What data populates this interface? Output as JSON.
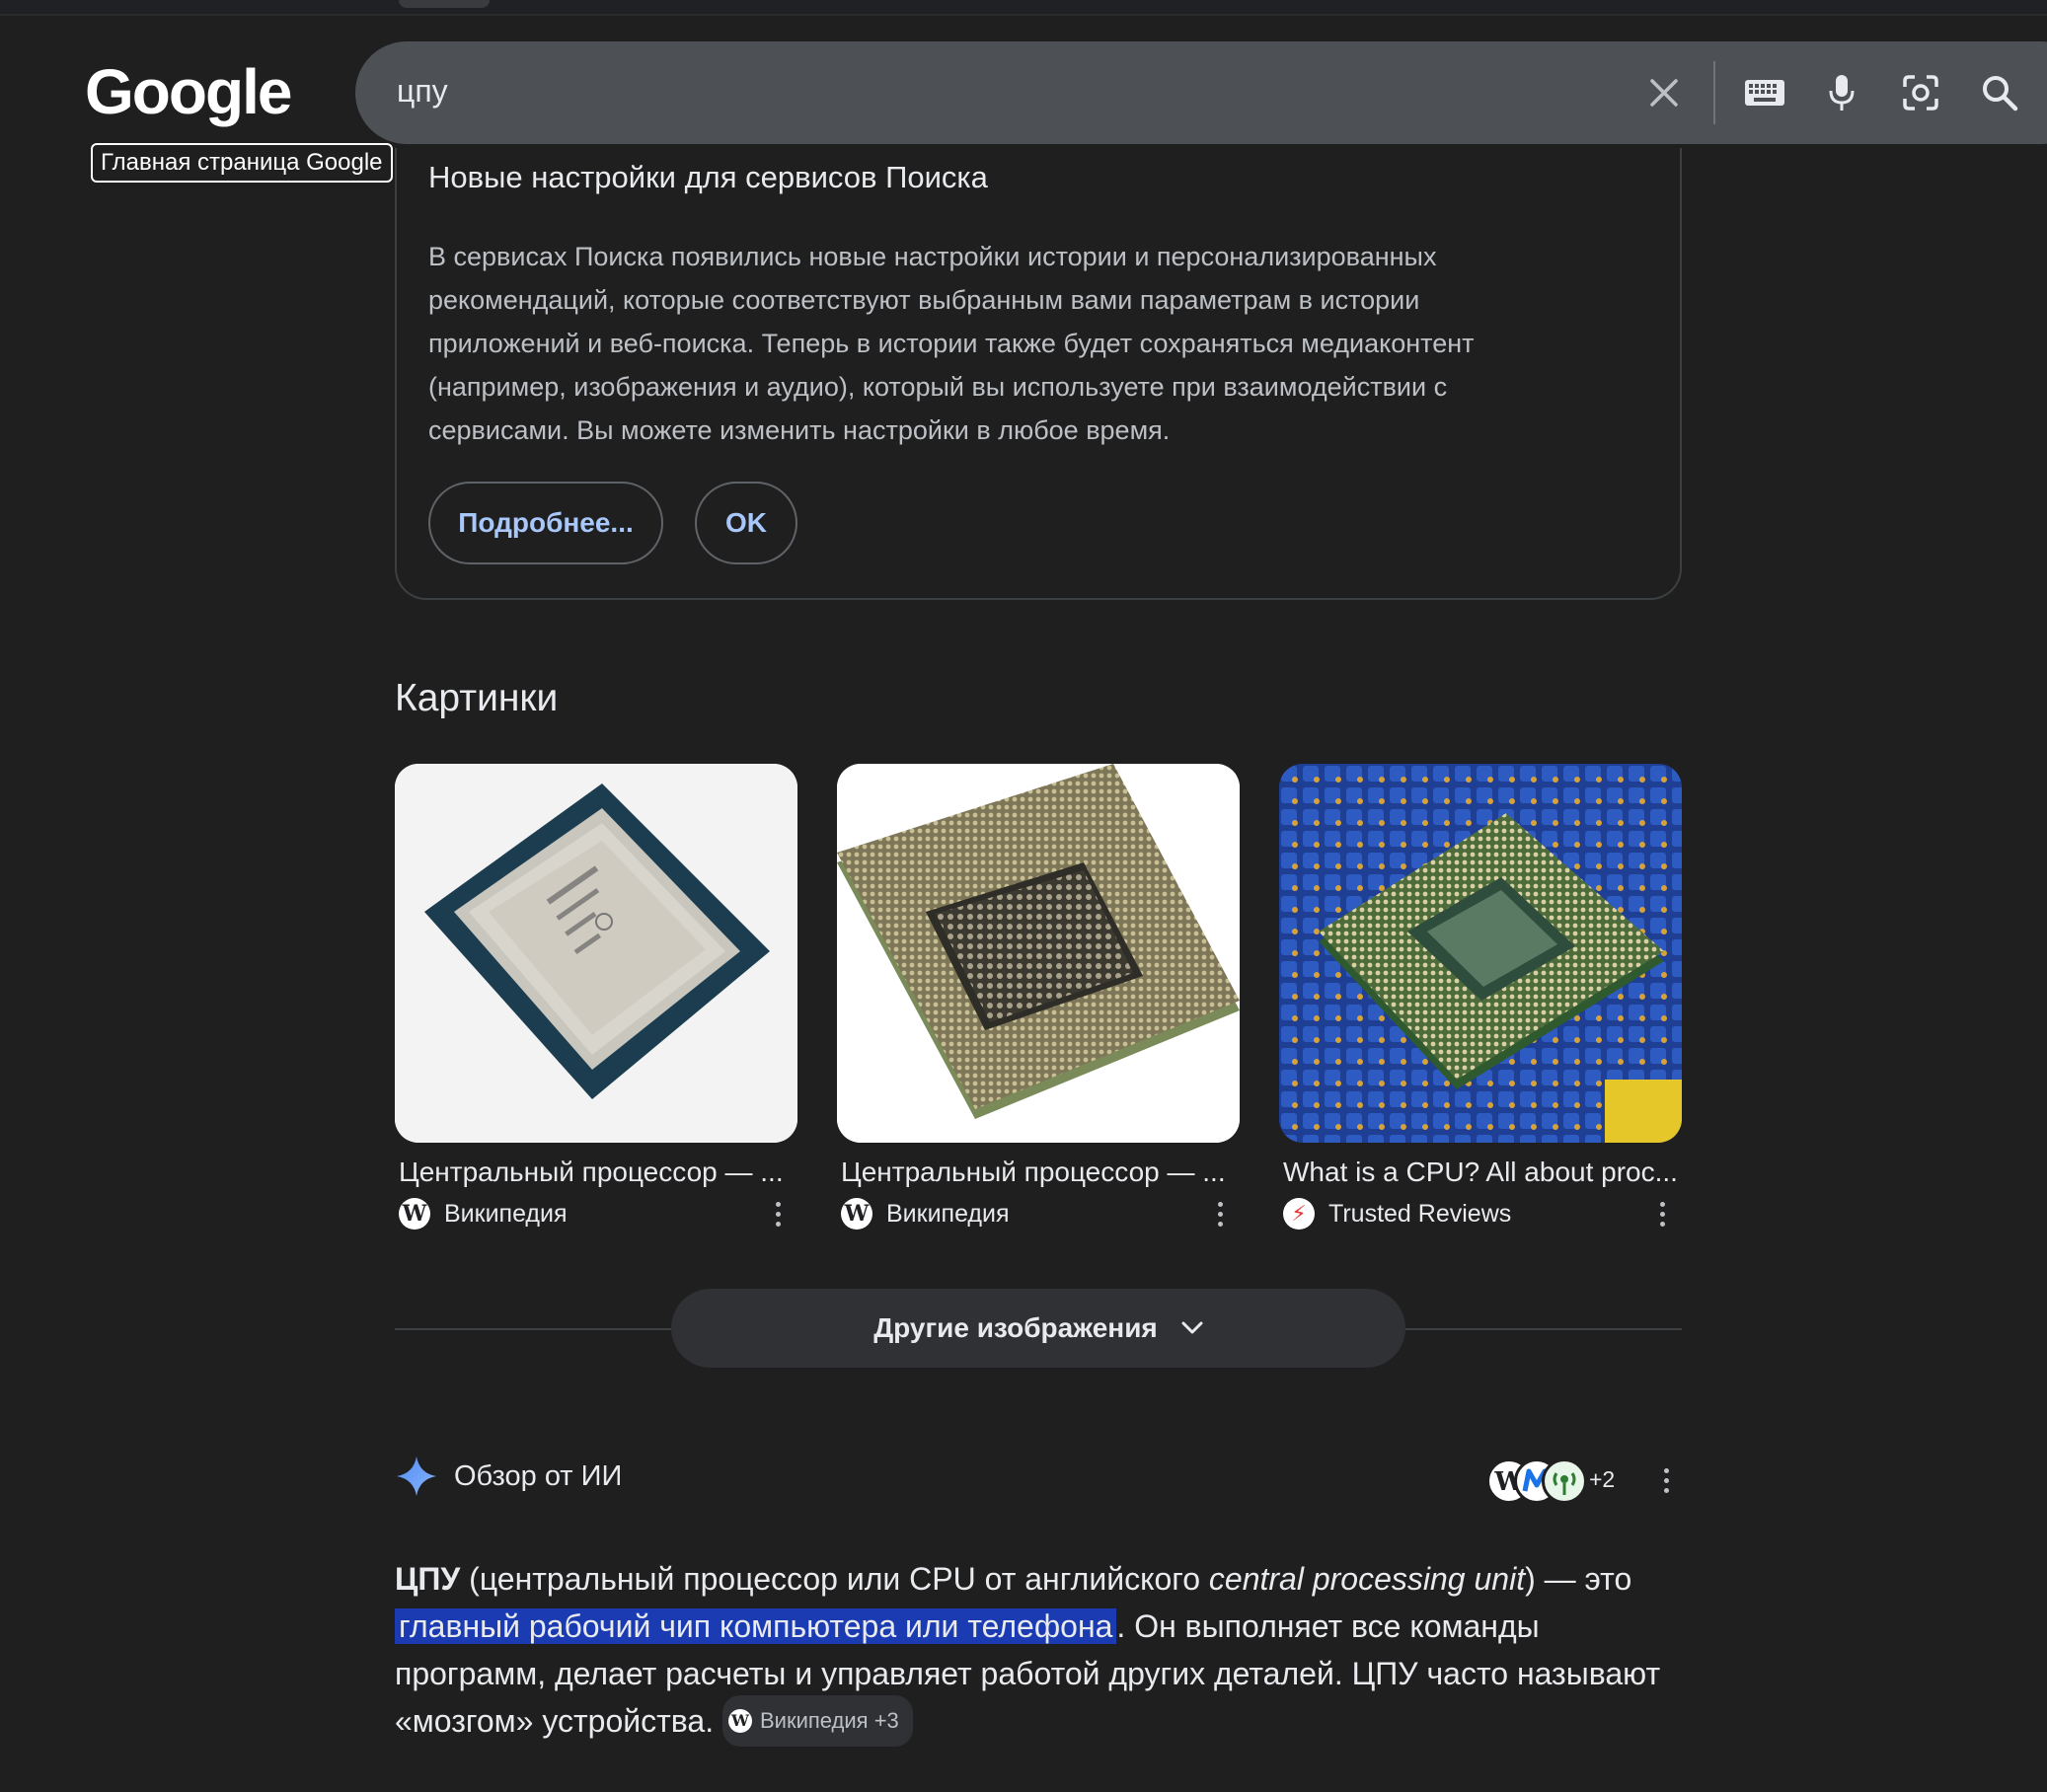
{
  "header": {
    "logo": "Google",
    "home_tooltip": "Главная страница Google",
    "search_value": "цпу",
    "icons": [
      "close-icon",
      "keyboard-icon",
      "mic-icon",
      "lens-icon",
      "search-icon"
    ]
  },
  "notice": {
    "title": "Новые настройки для сервисов Поиска",
    "text": "В сервисах Поиска появились новые настройки истории и персонализированных рекомендаций, которые соответствуют выбранным вами параметрам в истории приложений и веб-поиска. Теперь в истории также будет сохраняться медиаконтент (например, изображения и аудио), который вы используете при взаимодействии с сервисами. Вы можете изменить настройки в любое время.",
    "learn_more": "Подробнее...",
    "ok": "OK"
  },
  "images": {
    "title": "Картинки",
    "items": [
      {
        "caption": "Центральный процессор — ...",
        "source": "Википедия",
        "source_icon": "wikipedia-icon"
      },
      {
        "caption": "Центральный процессор — ...",
        "source": "Википедия",
        "source_icon": "wikipedia-icon"
      },
      {
        "caption": "What is a CPU? All about proc...",
        "source": "Trusted Reviews",
        "source_icon": "trusted-reviews-icon"
      }
    ],
    "more_button": "Другие изображения"
  },
  "ai_overview": {
    "title": "Обзор от ИИ",
    "sources_more": "+2",
    "term": "ЦПУ",
    "text_part1": " (центральный процессор или CPU от английского ",
    "text_italic": "central processing unit",
    "text_part2": ") — это ",
    "highlight": "главный рабочий чип компьютера или телефона",
    "text_part3": ". Он выполняет все команды программ, делает расчеты и управляет работой других деталей. ЦПУ часто называют «мозгом» устройства.",
    "chip_label": "Википедия +3"
  },
  "colors": {
    "background": "#1f1f1f",
    "searchbar": "#4d5156",
    "link_blue": "#a8c7fa",
    "highlight": "#1a3bb2"
  }
}
